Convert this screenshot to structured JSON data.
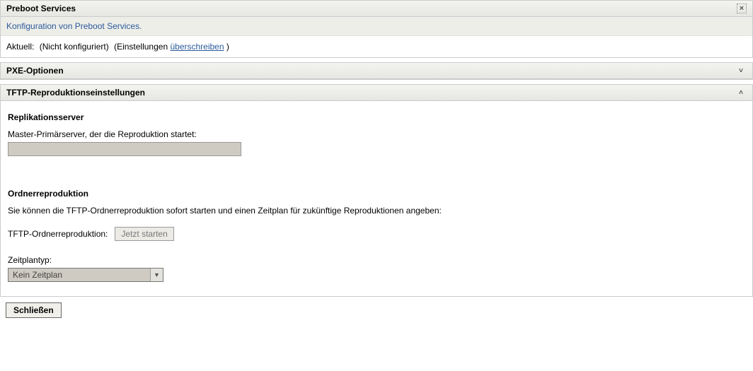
{
  "header": {
    "title": "Preboot Services",
    "subtitle": "Konfiguration von Preboot Services.",
    "status_label": "Aktuell:",
    "status_value": "(Nicht konfiguriert)",
    "settings_prefix": "(Einstellungen ",
    "override_link": "überschreiben",
    "settings_suffix": " )",
    "close_char": "×"
  },
  "sections": {
    "pxe": {
      "title": "PXE-Optionen"
    },
    "tftp": {
      "title": "TFTP-Reproduktionseinstellungen",
      "replication_server_heading": "Replikationsserver",
      "master_server_label": "Master-Primärserver, der die Reproduktion startet:",
      "master_server_value": "",
      "folder_replication_heading": "Ordnerreproduktion",
      "folder_replication_desc": "Sie können die TFTP-Ordnerreproduktion sofort starten und einen Zeitplan für zukünftige Reproduktionen angeben:",
      "tftp_folder_label": "TFTP-Ordnerreproduktion:",
      "start_now_label": "Jetzt starten",
      "schedule_type_label": "Zeitplantyp:",
      "schedule_type_value": "Kein Zeitplan"
    }
  },
  "footer": {
    "close_button": "Schließen"
  },
  "icons": {
    "chev_down": "˅",
    "chev_up": "˄",
    "triangle_down": "▼"
  }
}
